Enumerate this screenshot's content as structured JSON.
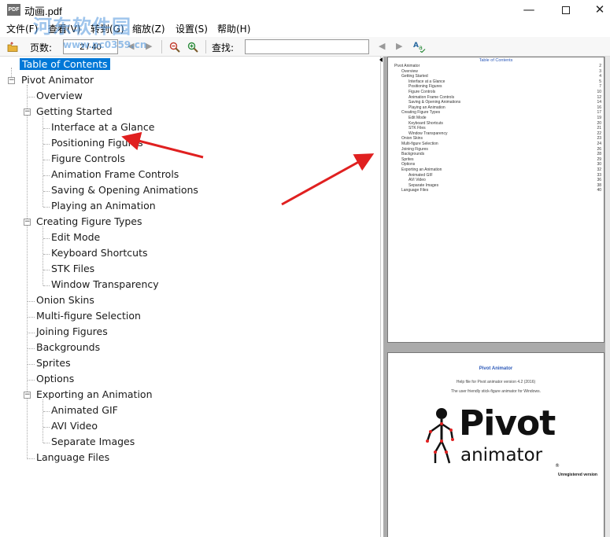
{
  "window": {
    "title": "动画.pdf",
    "app_icon_label": "PDF",
    "minimize_glyph": "—",
    "close_glyph": "✕"
  },
  "watermark": {
    "text": "河东软件园",
    "url": "www.pc0359.cn"
  },
  "menu": {
    "items": [
      "文件(F)",
      "查看(V)",
      "转到(G)",
      "缩放(Z)",
      "设置(S)",
      "帮助(H)"
    ]
  },
  "toolbar": {
    "page_label": "页数:",
    "page_value": "2 / 40",
    "find_label": "查找:",
    "find_value": ""
  },
  "toc_tree": {
    "root": "Table of Contents",
    "book": "Pivot Animator",
    "items": [
      {
        "label": "Overview"
      },
      {
        "label": "Getting Started",
        "children": [
          "Interface at a Glance",
          "Positioning Figures",
          "Figure Controls",
          "Animation Frame Controls",
          "Saving & Opening Animations",
          "Playing an Animation"
        ]
      },
      {
        "label": "Creating Figure Types",
        "children": [
          "Edit Mode",
          "Keyboard Shortcuts",
          "STK Files",
          "Window Transparency"
        ]
      },
      {
        "label": "Onion Skins"
      },
      {
        "label": "Multi-figure Selection"
      },
      {
        "label": "Joining Figures"
      },
      {
        "label": "Backgrounds"
      },
      {
        "label": "Sprites"
      },
      {
        "label": "Options"
      },
      {
        "label": "Exporting an Animation",
        "children": [
          "Animated GIF",
          "AVI Video",
          "Separate Images"
        ]
      },
      {
        "label": "Language Files"
      }
    ]
  },
  "preview": {
    "page1": {
      "title": "Table of Contents",
      "entries": [
        {
          "text": "Pivot Animator",
          "page": "2",
          "indent": 0
        },
        {
          "text": "Overview",
          "page": "3",
          "indent": 1
        },
        {
          "text": "Getting Started",
          "page": "4",
          "indent": 1
        },
        {
          "text": "Interface at a Glance",
          "page": "5",
          "indent": 2
        },
        {
          "text": "Positioning Figures",
          "page": "7",
          "indent": 2
        },
        {
          "text": "Figure Controls",
          "page": "10",
          "indent": 2
        },
        {
          "text": "Animation Frame Controls",
          "page": "12",
          "indent": 2
        },
        {
          "text": "Saving & Opening Animations",
          "page": "14",
          "indent": 2
        },
        {
          "text": "Playing an Animation",
          "page": "16",
          "indent": 2
        },
        {
          "text": "Creating Figure Types",
          "page": "17",
          "indent": 1
        },
        {
          "text": "Edit Mode",
          "page": "19",
          "indent": 2
        },
        {
          "text": "Keyboard Shortcuts",
          "page": "20",
          "indent": 2
        },
        {
          "text": "STK Files",
          "page": "21",
          "indent": 2
        },
        {
          "text": "Window Transparency",
          "page": "22",
          "indent": 2
        },
        {
          "text": "Onion Skins",
          "page": "23",
          "indent": 1
        },
        {
          "text": "Multi-figure Selection",
          "page": "24",
          "indent": 1
        },
        {
          "text": "Joining Figures",
          "page": "26",
          "indent": 1
        },
        {
          "text": "Backgrounds",
          "page": "28",
          "indent": 1
        },
        {
          "text": "Sprites",
          "page": "29",
          "indent": 1
        },
        {
          "text": "Options",
          "page": "30",
          "indent": 1
        },
        {
          "text": "Exporting an Animation",
          "page": "32",
          "indent": 1
        },
        {
          "text": "Animated GIF",
          "page": "33",
          "indent": 2
        },
        {
          "text": "AVI Video",
          "page": "36",
          "indent": 2
        },
        {
          "text": "Separate Images",
          "page": "38",
          "indent": 2
        },
        {
          "text": "Language Files",
          "page": "40",
          "indent": 1
        }
      ]
    },
    "page2": {
      "title": "Pivot Animator",
      "line1": "Help file for Pivot animator version 4.2 (2016)",
      "line2": "The user friendly stick-figure animator for Windows.",
      "logo_word1": "Pivot",
      "logo_word2": "animator",
      "logo_mark": "®",
      "unregistered": "Unregistered version"
    }
  },
  "colors": {
    "selection": "#0078d7",
    "annotation_arrow": "#e02020",
    "toc_title": "#2c59b8",
    "preview_bg": "#ababab"
  }
}
